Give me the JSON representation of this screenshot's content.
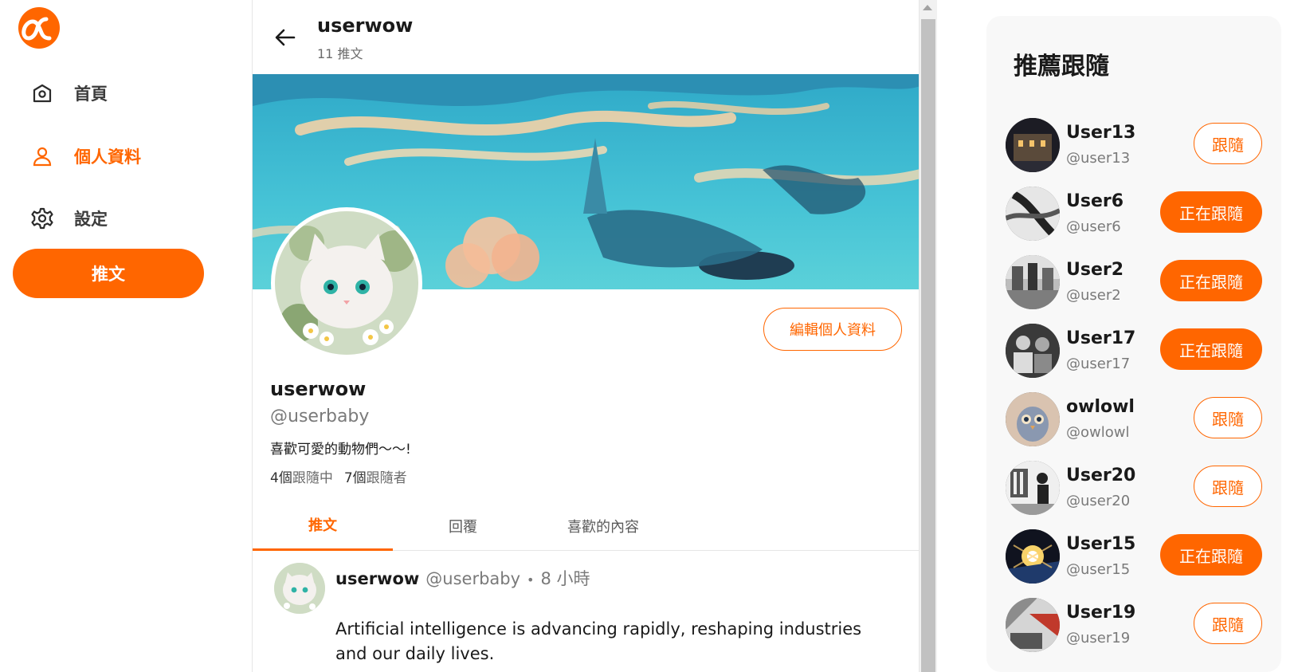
{
  "sidebar": {
    "logo_icon": "alpha-logo-icon",
    "items": [
      {
        "label": "首頁",
        "icon": "home-icon",
        "active": false
      },
      {
        "label": "個人資料",
        "icon": "user-icon",
        "active": true
      },
      {
        "label": "設定",
        "icon": "gear-icon",
        "active": false
      }
    ],
    "tweet_button": "推文"
  },
  "header": {
    "back_icon": "arrow-left-icon",
    "name": "userwow",
    "tweet_count": "11 推文"
  },
  "profile": {
    "name": "userwow",
    "handle": "@userbaby",
    "bio": "喜歡可愛的動物們〜〜!",
    "following_count": "4個",
    "following_label": "跟隨中",
    "followers_count": "7個",
    "followers_label": "跟隨者",
    "edit_button": "編輯個人資料"
  },
  "tabs": [
    {
      "label": "推文",
      "active": true
    },
    {
      "label": "回覆",
      "active": false
    },
    {
      "label": "喜歡的內容",
      "active": false
    }
  ],
  "tweets": [
    {
      "author": "userwow",
      "handle": "@userbaby",
      "separator": "•",
      "time": "8 小時",
      "text": "Artificial intelligence is advancing rapidly, reshaping industries and our daily lives."
    }
  ],
  "recommend": {
    "title": "推薦跟隨",
    "users": [
      {
        "name": "User13",
        "handle": "@user13",
        "button": "跟隨",
        "following": false
      },
      {
        "name": "User6",
        "handle": "@user6",
        "button": "正在跟隨",
        "following": true
      },
      {
        "name": "User2",
        "handle": "@user2",
        "button": "正在跟隨",
        "following": true
      },
      {
        "name": "User17",
        "handle": "@user17",
        "button": "正在跟隨",
        "following": true
      },
      {
        "name": "owlowl",
        "handle": "@owlowl",
        "button": "跟隨",
        "following": false
      },
      {
        "name": "User20",
        "handle": "@user20",
        "button": "跟隨",
        "following": false
      },
      {
        "name": "User15",
        "handle": "@user15",
        "button": "正在跟隨",
        "following": true
      },
      {
        "name": "User19",
        "handle": "@user19",
        "button": "跟隨",
        "following": false
      }
    ]
  },
  "colors": {
    "accent": "#ff6600",
    "text": "#1a1a1a",
    "muted": "#7a7a7a"
  }
}
